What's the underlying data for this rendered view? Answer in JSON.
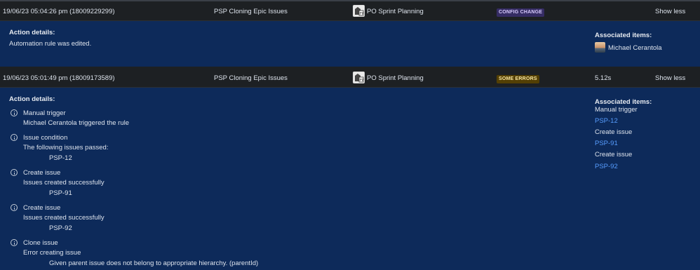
{
  "rows": [
    {
      "date": "19/06/23 05:04:26 pm (18009229299)",
      "rule": "PSP Cloning Epic Issues",
      "project": "PO Sprint Planning",
      "status": "CONFIG CHANGE",
      "duration": "",
      "toggle": "Show less"
    },
    {
      "date": "19/06/23 05:01:49 pm (18009173589)",
      "rule": "PSP Cloning Epic Issues",
      "project": "PO Sprint Planning",
      "status": "SOME ERRORS",
      "duration": "5.12s",
      "toggle": "Show less"
    }
  ],
  "detail1": {
    "action_title": "Action details:",
    "action_text": "Automation rule was edited.",
    "assoc_title": "Associated items:",
    "assoc_user": "Michael Cerantola"
  },
  "detail2": {
    "action_title": "Action details:",
    "steps": [
      {
        "name": "Manual trigger",
        "desc": "Michael Cerantola triggered the rule",
        "sub": ""
      },
      {
        "name": "Issue condition",
        "desc": "The following issues passed:",
        "sub": "PSP-12"
      },
      {
        "name": "Create issue",
        "desc": "Issues created successfully",
        "sub": "PSP-91"
      },
      {
        "name": "Create issue",
        "desc": "Issues created successfully",
        "sub": "PSP-92"
      },
      {
        "name": "Clone issue",
        "desc": "Error creating issue",
        "sub": "Given parent issue does not belong to appropriate hierarchy. (parentId)"
      }
    ],
    "assoc_title": "Associated items:",
    "assoc": [
      {
        "label": "Manual trigger",
        "link": false
      },
      {
        "label": "PSP-12",
        "link": true
      },
      {
        "label": "Create issue",
        "link": false
      },
      {
        "label": "PSP-91",
        "link": true
      },
      {
        "label": "Create issue",
        "link": false
      },
      {
        "label": "PSP-92",
        "link": true
      }
    ]
  },
  "colors": {
    "panel_bg": "#0d2a5a",
    "row_bg": "#1d2023",
    "link": "#579dff",
    "config_change_bg": "#352c63",
    "some_errors_bg": "#533f04"
  },
  "icons": [
    "project-avatar-icon",
    "info-icon",
    "user-avatar-icon"
  ]
}
